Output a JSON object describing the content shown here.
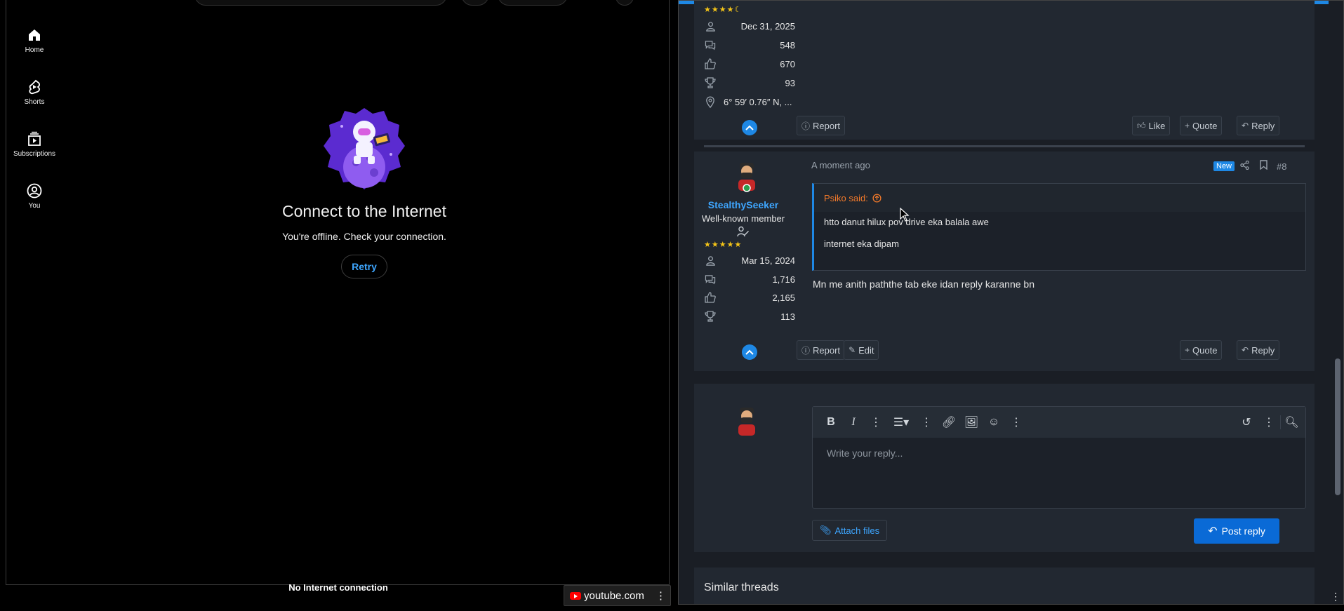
{
  "youtube": {
    "sidebar": [
      {
        "label": "Home",
        "icon": "home-icon"
      },
      {
        "label": "Shorts",
        "icon": "shorts-icon"
      },
      {
        "label": "Subscriptions",
        "icon": "subscriptions-icon"
      },
      {
        "label": "You",
        "icon": "you-icon"
      }
    ],
    "offline_title": "Connect to the Internet",
    "offline_message": "You're offline. Check your connection.",
    "retry_label": "Retry",
    "footer_message": "No Internet connection",
    "taskbar_label": "youtube.com"
  },
  "forum": {
    "accent_color": "#1e88e5",
    "post7": {
      "stars": "★★★★☾",
      "joined": "Dec 31, 2025",
      "messages": "548",
      "reactions": "670",
      "points": "93",
      "location": "6° 59′ 0.76″ N, ...",
      "actions": {
        "report": "Report",
        "like": "Like",
        "quote": "Quote",
        "reply": "Reply"
      }
    },
    "post8": {
      "username": "StealthySeeker",
      "role": "Well-known member",
      "stars": "★★★★★",
      "joined": "Mar 15, 2024",
      "messages": "1,716",
      "reactions": "2,165",
      "points": "113",
      "time": "A moment ago",
      "badge_new": "New",
      "post_number": "#8",
      "quote": {
        "author": "Psiko said:",
        "line1": "htto danut hilux pov drive eka balala awe",
        "line2": "internet eka dipam"
      },
      "body": "Mn me anith paththe tab eke idan reply karanne bn",
      "actions": {
        "report": "Report",
        "edit": "Edit",
        "quote": "Quote",
        "reply": "Reply"
      }
    },
    "reply": {
      "placeholder": "Write your reply...",
      "attach_label": "Attach files",
      "post_label": "Post reply"
    },
    "similar_threads_title": "Similar threads"
  }
}
